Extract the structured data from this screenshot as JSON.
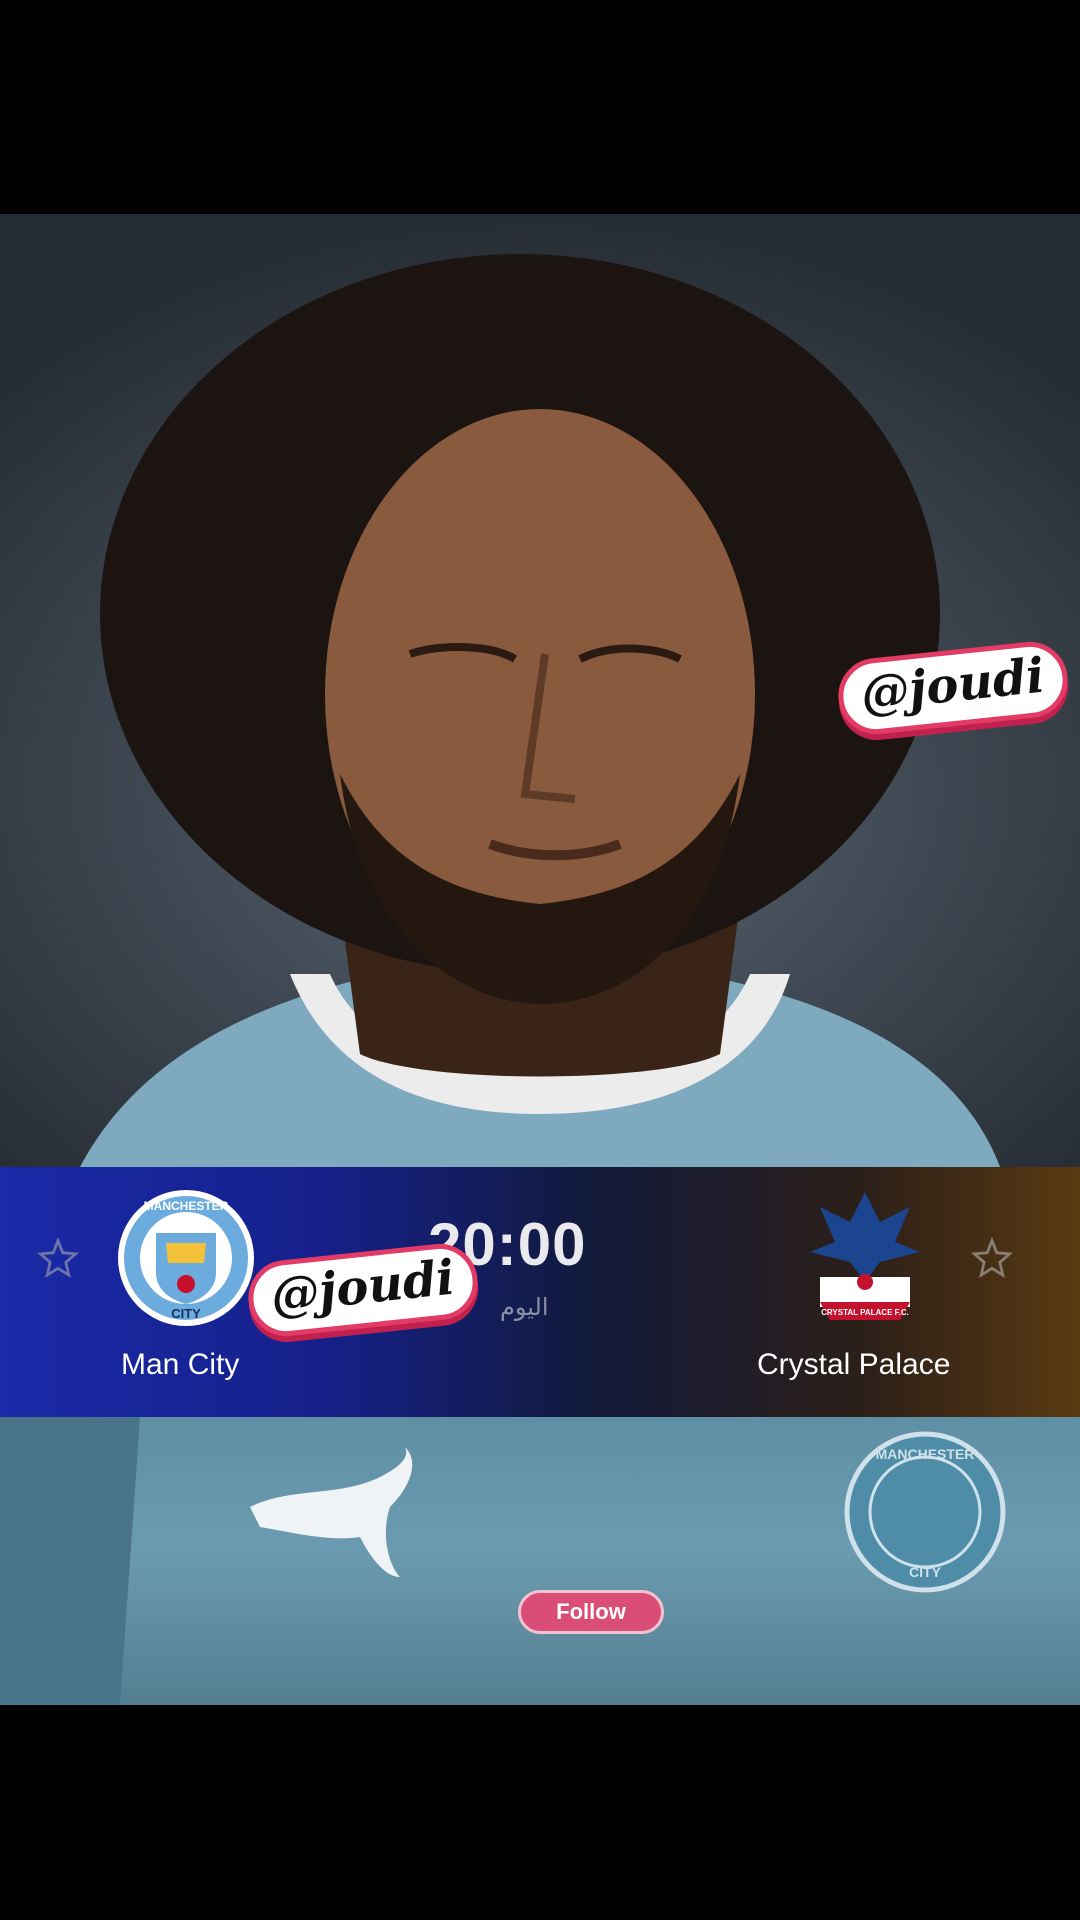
{
  "match": {
    "home_team": "Man City",
    "away_team": "Crystal Palace",
    "time": "20:00",
    "day_label": "اليوم"
  },
  "overlay": {
    "sticker_text": "@joudi"
  },
  "actions": {
    "follow_label": "Follow"
  },
  "badges": {
    "home_text_top": "MANCHESTER",
    "home_text_bottom": "CITY",
    "away_text": "CRYSTAL PALACE F.C.",
    "shirt_badge_top": "MANCHESTER",
    "shirt_badge_bottom": "CITY"
  },
  "colors": {
    "card_left": "#1a2aa8",
    "card_right": "#5a3a12",
    "sticker_border": "#e23b66",
    "follow_bg": "#d94d77"
  },
  "icons": {
    "favorite_home": "star-icon",
    "favorite_away": "star-icon"
  }
}
